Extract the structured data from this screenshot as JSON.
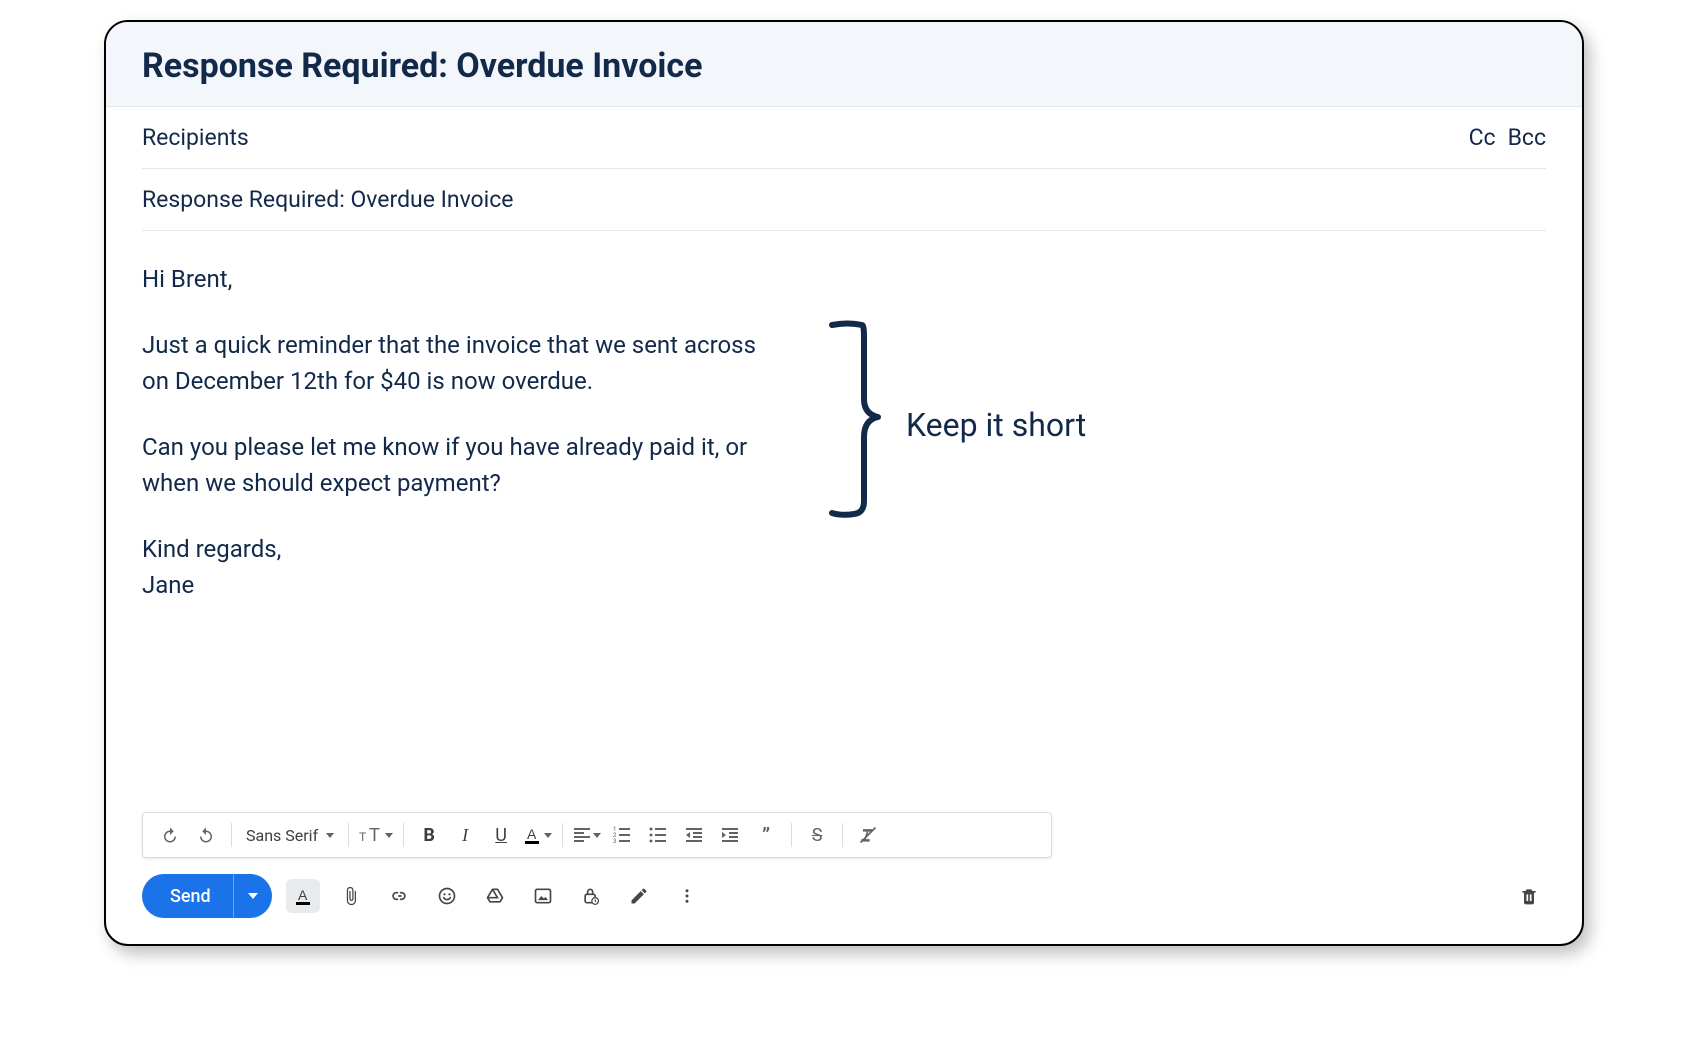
{
  "header": {
    "title": "Response Required: Overdue Invoice"
  },
  "fields": {
    "recipients_label": "Recipients",
    "cc_label": "Cc",
    "bcc_label": "Bcc",
    "subject": "Response Required: Overdue Invoice"
  },
  "body": {
    "greeting": "Hi Brent,",
    "para1": "Just a quick reminder that the invoice that we sent across on December 12th for $40 is now overdue.",
    "para2": "Can you please let me know if you have already paid it, or when we should expect payment?",
    "closing": "Kind regards,",
    "signature": "Jane"
  },
  "annotation": {
    "label": "Keep it short"
  },
  "format_toolbar": {
    "font_family": "Sans Serif"
  },
  "actions": {
    "send_label": "Send"
  }
}
